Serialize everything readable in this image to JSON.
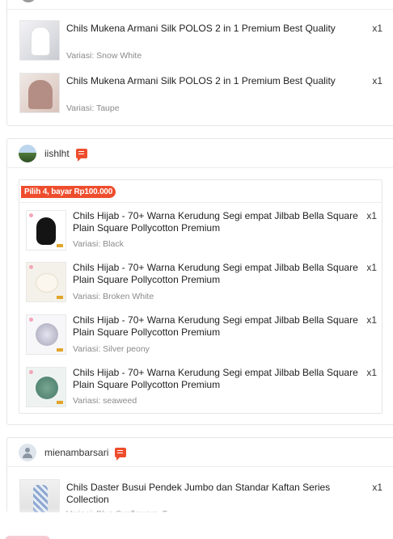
{
  "top_shop": {
    "items": [
      {
        "title": "Chils Mukena Armani Silk POLOS 2 in 1 Premium Best Quality",
        "qty": "x1",
        "variant": "Variasi: Snow White",
        "image": "mukena-white"
      },
      {
        "title": "Chils Mukena Armani Silk POLOS 2 in 1 Premium Best Quality",
        "qty": "x1",
        "variant": "Variasi: Taupe",
        "image": "mukena-taupe"
      }
    ]
  },
  "shop_iishlht": {
    "name": "iishlht",
    "avatar_icon": "avatar-photo-icon",
    "chat_icon": "chat-icon",
    "promo_label": "Pilih 4, bayar Rp100.000",
    "items": [
      {
        "title": "Chils Hijab - 70+ Warna Kerudung Segi empat Jilbab Bella Square Plain Square Pollycotton Premium",
        "qty": "x1",
        "variant": "Variasi: Black",
        "image": "hijab-black"
      },
      {
        "title": "Chils Hijab - 70+ Warna Kerudung Segi empat Jilbab Bella Square Plain Square Pollycotton Premium",
        "qty": "x1",
        "variant": "Variasi: Broken White",
        "image": "hijab-white"
      },
      {
        "title": "Chils Hijab - 70+ Warna Kerudung Segi empat Jilbab Bella Square Plain Square Pollycotton Premium",
        "qty": "x1",
        "variant": "Variasi: Silver peony",
        "image": "hijab-silver"
      },
      {
        "title": "Chils Hijab - 70+ Warna Kerudung Segi empat Jilbab Bella Square Plain Square Pollycotton Premium",
        "qty": "x1",
        "variant": "Variasi: seaweed",
        "image": "hijab-green"
      }
    ]
  },
  "shop_mienambarsari": {
    "name": "mienambarsari",
    "avatar_icon": "default-avatar-icon",
    "chat_icon": "chat-icon",
    "items": [
      {
        "title": "Chils Daster Busui Pendek Jumbo dan Standar Kaftan Series Collection",
        "qty": "x1",
        "variant": "Variasi: Blue Sunflowers, T",
        "image": "daster"
      }
    ]
  },
  "colors": {
    "accent": "#ee4d2d",
    "muted_text": "#8a8a8a",
    "border": "#e6e6e6"
  }
}
